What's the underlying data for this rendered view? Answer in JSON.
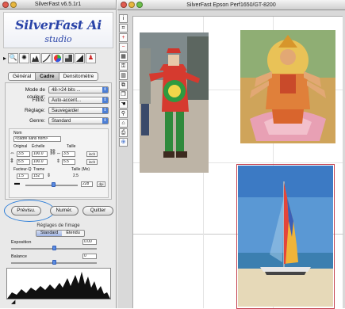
{
  "left_window": {
    "title": "SilverFast v6.5.1r1",
    "logo_main": "SilverFast Ai",
    "logo_sub": "studio",
    "tools": [
      "magnifier-icon",
      "gear-icon",
      "histogram-icon",
      "gradation-icon",
      "color-wheel-icon",
      "hsl-icon",
      "sharpen-icon",
      "person-icon"
    ],
    "tabs": [
      "Général",
      "Cadre",
      "Densitomètre"
    ],
    "selected_tab": "Cadre",
    "mode_label": "Mode de couleur:",
    "mode_value": "48->24 bits ...",
    "filtre_label": "Filtre:",
    "filtre_value": "Auto-accent...",
    "reglage_label": "Réglage:",
    "reglage_value": "Sauvegarder",
    "genre_label": "Genre:",
    "genre_value": "Standard",
    "nom_label": "Nom",
    "nom_value": "<cadre sans nom>",
    "original_label": "Original",
    "echelle_label": "Échelle",
    "taille_label": "Taille",
    "width_original": "3.5",
    "width_echelle": "100.0",
    "width_taille": "3.5",
    "height_original": "5.5",
    "height_echelle": "100.0",
    "height_taille": "5.5",
    "unit_label": "inch",
    "facteur_label": "Facteur-Q",
    "trame_label": "Trame",
    "taille_mo_label": "Taille (Mo)",
    "facteur_value": "1.5",
    "trame_value": "152",
    "taille_mo_value": "2.5",
    "resolution_value": "228",
    "resolution_unit": "dpi",
    "preview_button": "Prévisu.",
    "scan_button": "Numér.",
    "quit_button": "Quitter",
    "reglages_title": "Réglages de l'image",
    "seg_standard": "Standard",
    "seg_etendu": "Étendu",
    "exposition_label": "Exposition",
    "exposition_value": "0.00",
    "balance_label": "Balance",
    "balance_value": "0"
  },
  "right_window": {
    "title": "SilverFast Epson Perf1650/GT-8200",
    "tools": [
      "info-icon",
      "crop-icon",
      "plus-icon",
      "minus-icon",
      "descreen-icon",
      "lock-icon",
      "grid-icon",
      "frame-icon",
      "copy-icon",
      "hand-icon",
      "pipette-icon",
      "tray-icon",
      "print-icon",
      "zoom-icon"
    ]
  }
}
